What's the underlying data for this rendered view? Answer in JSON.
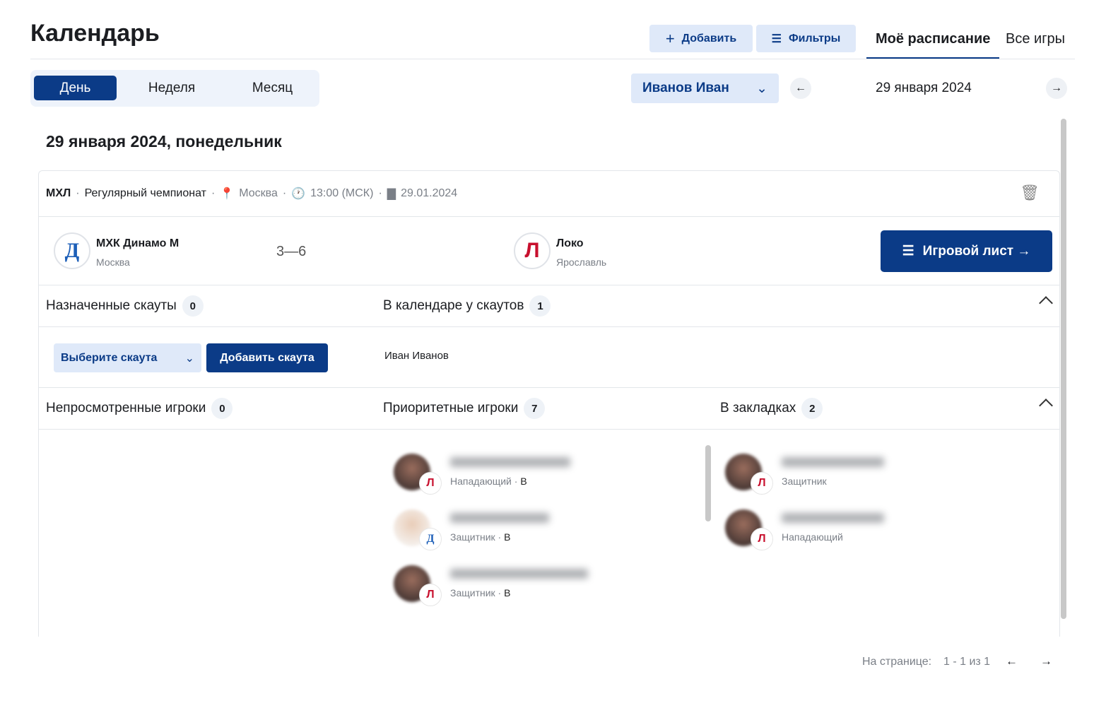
{
  "header": {
    "title": "Календарь",
    "add_label": "Добавить",
    "filters_label": "Фильтры",
    "tabs": [
      "Моё расписание",
      "Все игры"
    ]
  },
  "view": {
    "segments": [
      "День",
      "Неделя",
      "Месяц"
    ],
    "active": "День"
  },
  "user_select": "Иванов Иван",
  "date_nav": {
    "current": "29 января 2024"
  },
  "day_title": "29 января 2024, понедельник",
  "game": {
    "league": "МХЛ",
    "stage": "Регулярный чемпионат",
    "city": "Москва",
    "time": "13:00 (МСК)",
    "date": "29.01.2024",
    "home": {
      "name": "МХК Динамо М",
      "city": "Москва"
    },
    "score": "3—6",
    "away": {
      "name": "Локо",
      "city": "Ярославль"
    },
    "game_sheet_label": "Игровой лист →"
  },
  "scouts": {
    "assigned_label": "Назначенные скауты",
    "assigned_count": "0",
    "calendar_label": "В календаре у скаутов",
    "calendar_count": "1",
    "select_placeholder": "Выберите скаута",
    "add_label": "Добавить скаута",
    "names": [
      "Иван Иванов"
    ]
  },
  "players": {
    "unviewed_label": "Непросмотренные игроки",
    "unviewed_count": "0",
    "priority_label": "Приоритетные игроки",
    "priority_count": "7",
    "bookmarks_label": "В закладках",
    "bookmarks_count": "2",
    "priority": [
      {
        "pos": "Нападающий",
        "grade": "В",
        "team": "loko"
      },
      {
        "pos": "Защитник",
        "grade": "В",
        "team": "dynamo"
      },
      {
        "pos": "Защитник",
        "grade": "В",
        "team": "loko"
      }
    ],
    "bookmarks": [
      {
        "pos": "Защитник",
        "team": "loko"
      },
      {
        "pos": "Нападающий",
        "team": "loko"
      }
    ]
  },
  "pagination": {
    "label": "На странице:",
    "range": "1 - 1 из 1"
  },
  "colors": {
    "primary": "#0b3b87",
    "light": "#dfe9f9"
  }
}
